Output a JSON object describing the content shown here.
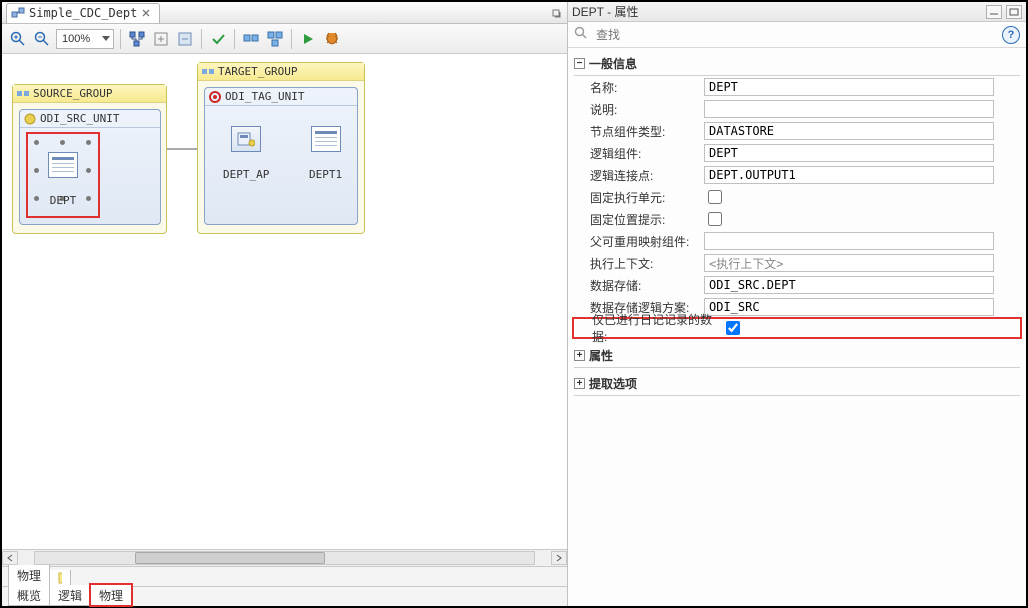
{
  "tab": {
    "title": "Simple_CDC_Dept",
    "close_char": "×"
  },
  "toolbar": {
    "zoom": "100%"
  },
  "diagram": {
    "source_group": "SOURCE_GROUP",
    "target_group": "TARGET_GROUP",
    "src_unit": "ODI_SRC_UNIT",
    "tgt_unit": "ODI_TAG_UNIT",
    "node_dept": "DEPT",
    "node_dept_ap": "DEPT_AP",
    "node_dept1": "DEPT1"
  },
  "bottom_tabs1": {
    "t0": "物理"
  },
  "bottom_tabs2": {
    "t0": "概览",
    "t1": "逻辑",
    "t2": "物理"
  },
  "props_panel": {
    "title": "DEPT - 属性",
    "search_placeholder": "查找",
    "section_general": "一般信息",
    "section_attrs": "属性",
    "section_extract": "提取选项",
    "rows": {
      "name": {
        "label": "名称:",
        "value": "DEPT"
      },
      "desc": {
        "label": "说明:",
        "value": ""
      },
      "nodetype": {
        "label": "节点组件类型:",
        "value": "DATASTORE"
      },
      "logic": {
        "label": "逻辑组件:",
        "value": "DEPT"
      },
      "connpt": {
        "label": "逻辑连接点:",
        "value": "DEPT.OUTPUT1"
      },
      "fixedeu": {
        "label": "固定执行单元:"
      },
      "fixedpos": {
        "label": "固定位置提示:"
      },
      "parent": {
        "label": "父可重用映射组件:",
        "value": ""
      },
      "context": {
        "label": "执行上下文:",
        "value": "<执行上下文>"
      },
      "store": {
        "label": "数据存储:",
        "value": "ODI_SRC.DEPT"
      },
      "schema": {
        "label": "数据存储逻辑方案:",
        "value": "ODI_SRC"
      },
      "journal": {
        "label": "仅已进行日记记录的数据:"
      }
    }
  }
}
